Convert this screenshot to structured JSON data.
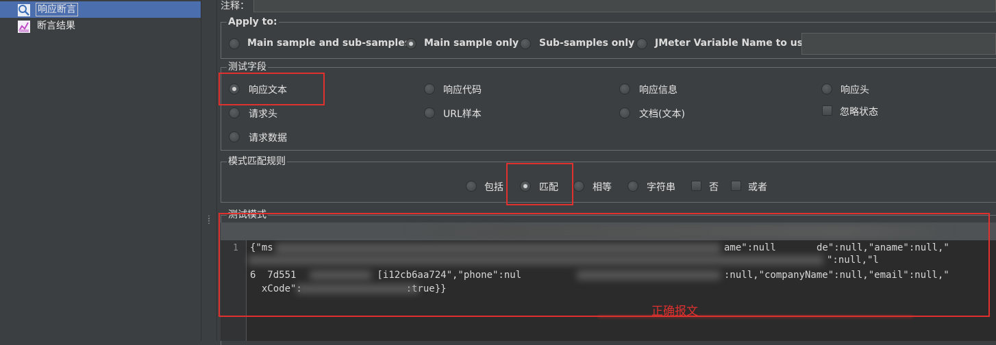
{
  "tree": {
    "items": [
      {
        "label": "响应断言",
        "icon": "magnifier-assertion-icon",
        "selected": true
      },
      {
        "label": "断言结果",
        "icon": "graph-listener-icon",
        "selected": false
      }
    ]
  },
  "panel": {
    "comments_label": "注释：",
    "apply_to": {
      "title": "Apply to:",
      "options": [
        "Main sample and sub-samples",
        "Main sample only",
        "Sub-samples only",
        "JMeter Variable Name to use"
      ],
      "selected": "Main sample only",
      "variable_value": ""
    },
    "test_field": {
      "title": "测试字段",
      "options": [
        "响应文本",
        "响应代码",
        "响应信息",
        "响应头",
        "请求头",
        "URL样本",
        "文档(文本)",
        "请求数据"
      ],
      "selected": "响应文本",
      "ignore_status_label": "忽略状态"
    },
    "pattern_rules": {
      "title": "模式匹配规则",
      "options": [
        "包括",
        "匹配",
        "相等",
        "字符串"
      ],
      "selected": "匹配",
      "not_label": "否",
      "or_label": "或者"
    },
    "test_pattern": {
      "title": "测试模式",
      "line_number": "1",
      "lines": [
        "{\"ms",
        "6  7d551              [i12cb6aa724\",\"phone\":nul",
        "  xCode\":                  :true}}"
      ],
      "fragments": [
        "ame\":null",
        "de\":null,\"aname\":null,\"",
        "\":null,\"l",
        ":null,\"companyName\":null,\"email\":null,\""
      ]
    },
    "annotation": "正确报文"
  },
  "colors": {
    "highlight_red": "#e0312f",
    "selection_blue": "#4b6eaf",
    "background": "#3c3f41"
  }
}
